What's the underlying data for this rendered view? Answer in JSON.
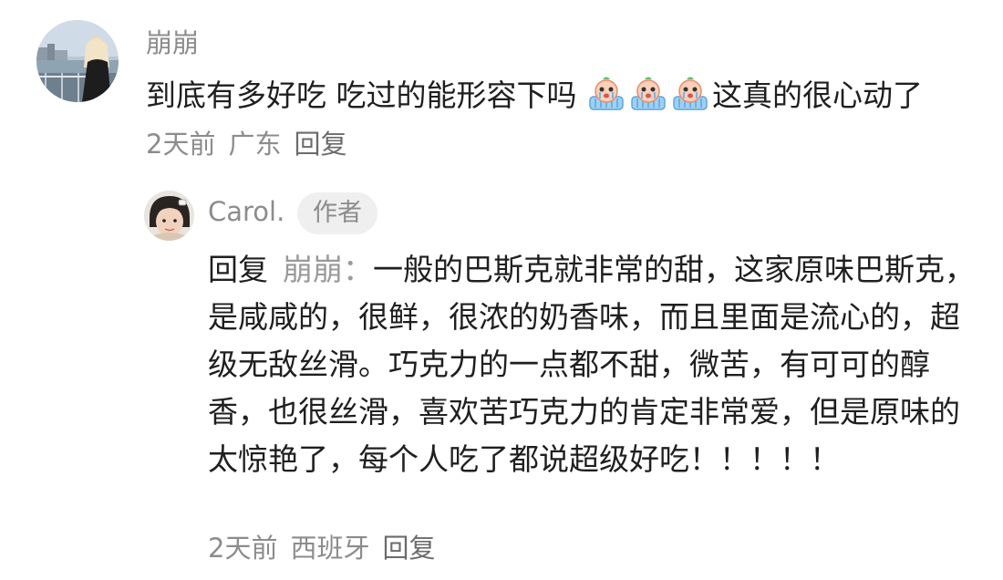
{
  "main_comment": {
    "username": "崩崩",
    "text_part1": "到底有多好吃 吃过的能形容下吗 ",
    "emojis": [
      "crying-face-emoji",
      "crying-face-emoji",
      "crying-face-emoji"
    ],
    "text_part2": "这真的很心动了",
    "time": "2天前",
    "location": "广东",
    "reply_label": "回复"
  },
  "reply_comment": {
    "username": "Carol.",
    "badge": "作者",
    "reply_prefix": "回复",
    "reply_target": "崩崩：",
    "text": "一般的巴斯克就非常的甜，这家原味巴斯克，是咸咸的，很鲜，很浓的奶香味，而且里面是流心的，超级无敌丝滑。巧克力的一点都不甜，微苦，有可可的醇香，也很丝滑，喜欢苦巧克力的肯定非常爱，但是原味的太惊艳了，每个人吃了都说超级好吃！！！！！",
    "time": "2天前",
    "location": "西班牙",
    "reply_label": "回复"
  },
  "colors": {
    "text": "#1f1f1f",
    "meta": "#8c8c8c",
    "badge_bg": "#efefef"
  }
}
